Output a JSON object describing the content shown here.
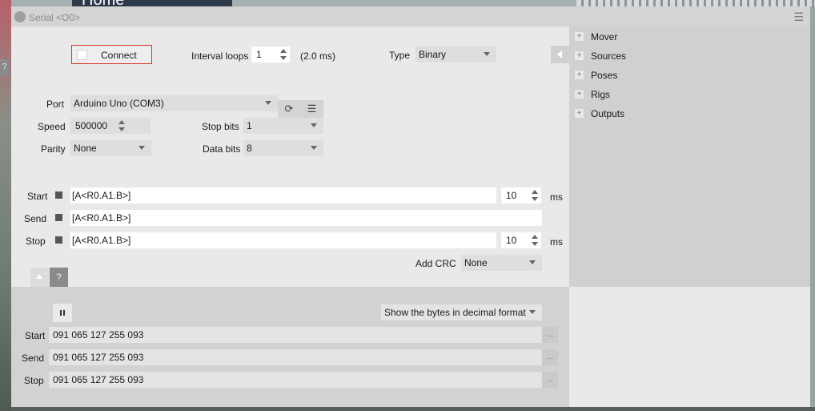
{
  "background": {
    "home_text": "Home"
  },
  "side_help": "?",
  "window": {
    "title": "Serial <O0>",
    "menu_icon": "hamburger-icon"
  },
  "connect": {
    "label": "Connect"
  },
  "interval": {
    "label": "Interval loops",
    "value": "1",
    "ms_text": "(2.0 ms)"
  },
  "type": {
    "label": "Type",
    "value": "Binary"
  },
  "port": {
    "label": "Port",
    "value": "Arduino Uno (COM3)",
    "refresh_icon": "refresh-icon",
    "menu_icon": "list-icon"
  },
  "speed": {
    "label": "Speed",
    "value": "500000"
  },
  "stop_bits": {
    "label": "Stop bits",
    "value": "1"
  },
  "parity": {
    "label": "Parity",
    "value": "None"
  },
  "data_bits": {
    "label": "Data bits",
    "value": "8"
  },
  "messages": {
    "start": {
      "label": "Start",
      "value": "[A<R0.A1.B>]",
      "delay": "10",
      "unit": "ms"
    },
    "send": {
      "label": "Send",
      "value": "[A<R0.A1.B>]"
    },
    "stop": {
      "label": "Stop",
      "value": "[A<R0.A1.B>]",
      "delay": "10",
      "unit": "ms"
    }
  },
  "crc": {
    "label": "Add CRC",
    "value": "None"
  },
  "help_label": "?",
  "log": {
    "format": "Show the bytes in decimal format",
    "rows": [
      {
        "label": "Start",
        "value": "091 065 127 255 093",
        "more": "..."
      },
      {
        "label": "Send",
        "value": "091 065 127 255 093",
        "more": "..."
      },
      {
        "label": "Stop",
        "value": "091 065 127 255 093",
        "more": "..."
      }
    ]
  },
  "sidebar": {
    "items": [
      {
        "label": "Mover"
      },
      {
        "label": "Sources"
      },
      {
        "label": "Poses"
      },
      {
        "label": "Rigs"
      },
      {
        "label": "Outputs"
      }
    ]
  }
}
